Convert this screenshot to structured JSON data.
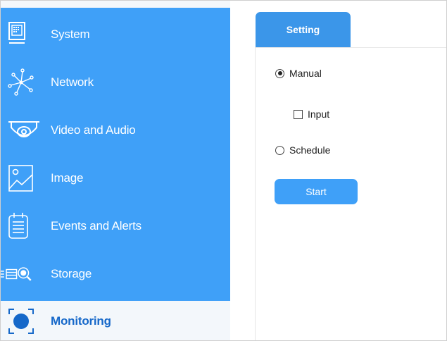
{
  "sidebar": {
    "items": [
      {
        "label": "System",
        "icon": "monitor-icon",
        "active": false
      },
      {
        "label": "Network",
        "icon": "network-icon",
        "active": false
      },
      {
        "label": "Video and Audio",
        "icon": "dome-camera-icon",
        "active": false
      },
      {
        "label": "Image",
        "icon": "image-icon",
        "active": false
      },
      {
        "label": "Events and Alerts",
        "icon": "calendar-list-icon",
        "active": false
      },
      {
        "label": "Storage",
        "icon": "storage-search-icon",
        "active": false
      },
      {
        "label": "Monitoring",
        "icon": "monitoring-target-icon",
        "active": true
      }
    ]
  },
  "tabs": [
    {
      "label": "Setting",
      "active": true
    }
  ],
  "form": {
    "manual_label": "Manual",
    "manual_selected": true,
    "input_label": "Input",
    "input_checked": false,
    "schedule_label": "Schedule",
    "schedule_selected": false,
    "start_label": "Start"
  },
  "colors": {
    "sidebar_blue": "#3fa0f8",
    "tab_blue": "#3b96e9",
    "active_text": "#1668c9",
    "active_bg": "#f3f7fb"
  }
}
